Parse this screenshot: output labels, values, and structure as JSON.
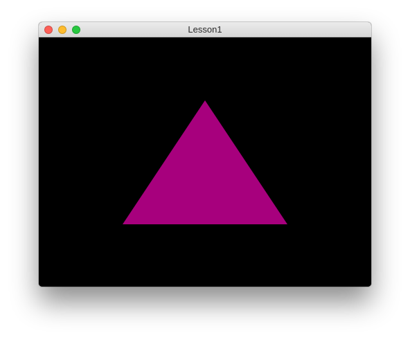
{
  "window": {
    "title": "Lesson1",
    "controls": {
      "close_color": "#fe5f57",
      "minimize_color": "#febc2e",
      "maximize_color": "#28c840"
    }
  },
  "canvas": {
    "background_color": "#000000",
    "shape": {
      "type": "triangle",
      "fill_color": "#a7007d"
    }
  }
}
